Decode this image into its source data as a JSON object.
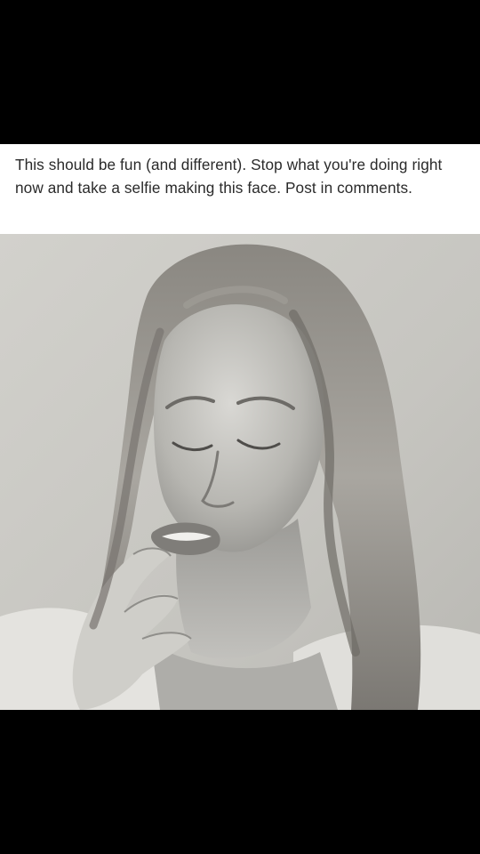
{
  "post": {
    "caption": "This should be fun (and different). Stop what you're doing right now and take a selfie making this face. Post in comments."
  },
  "photo": {
    "subject": "black-and-white portrait of a woman with eyes closed and lips parted, fingers touching chin"
  },
  "colors": {
    "background": "#000000",
    "card": "#ffffff",
    "text": "#2a2a2a"
  }
}
